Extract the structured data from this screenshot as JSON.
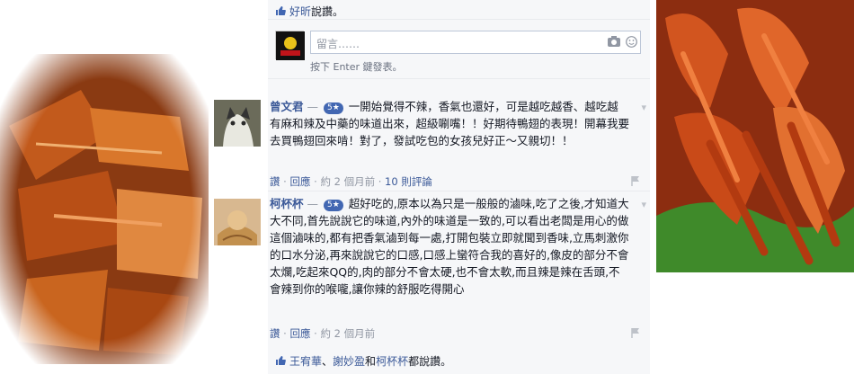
{
  "top_like": {
    "name": "好昕",
    "suffix": "說讚。"
  },
  "composer": {
    "placeholder": "留言……",
    "hint": "按下 Enter 鍵發表。",
    "icons": [
      "camera-icon",
      "smiley-icon"
    ]
  },
  "comments": [
    {
      "author": "曾文君",
      "rating": "5★",
      "text": "一開始覺得不辣，香氣也還好，可是越吃越香、越吃越有麻和辣及中藥的味道出來，超級唰嘴！！好期待鴨翅的表現！開幕我要去買鴨翅回來啃！對了，發試吃包的女孩兒好正～又親切！！",
      "actions": {
        "like": "讚",
        "reply": "回應",
        "time": "約 2 個月前",
        "comments": "10 則評論"
      }
    },
    {
      "author": "柯杯杯",
      "rating": "5★",
      "text": "超好吃的,原本以為只是一般般的滷味,吃了之後,才知道大大不同,首先說說它的味道,內外的味道是一致的,可以看出老闆是用心的做這個滷味的,都有把香氣滷到每一處,打開包裝立即就聞到香味,立馬刺激你的口水分泌,再來說說它的口感,口感上蠻符合我的喜好的,像皮的部分不會太爛,吃起來QQ的,肉的部分不會太硬,也不會太軟,而且辣是辣在舌頭,不會辣到你的喉嚨,讓你辣的舒服吃得開心",
      "actions": {
        "like": "讚",
        "reply": "回應",
        "time": "約 2 個月前"
      }
    }
  ],
  "footer_like": {
    "names": [
      "王宥華",
      "謝妙盈",
      "柯杯杯"
    ],
    "joiners": [
      "、",
      "和"
    ],
    "suffix": "都說讚。"
  }
}
